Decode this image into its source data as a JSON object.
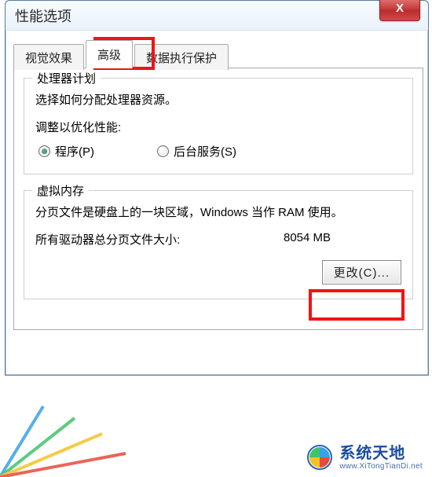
{
  "window": {
    "title": "性能选项",
    "close_label": "X"
  },
  "tabs": {
    "items": [
      {
        "label": "视觉效果"
      },
      {
        "label": "高级"
      },
      {
        "label": "数据执行保护"
      }
    ],
    "active_index": 1
  },
  "processor": {
    "group_title": "处理器计划",
    "desc": "选择如何分配处理器资源。",
    "adjust_label": "调整以优化性能:",
    "radios": [
      {
        "label": "程序(P)",
        "checked": true
      },
      {
        "label": "后台服务(S)",
        "checked": false
      }
    ]
  },
  "virtual_memory": {
    "group_title": "虚拟内存",
    "desc": "分页文件是硬盘上的一块区域，Windows 当作 RAM 使用。",
    "total_label": "所有驱动器总分页文件大小:",
    "total_value": "8054 MB",
    "change_button": "更改(C)..."
  },
  "watermark": {
    "cn": "系统天地",
    "en": "www.XiTongTianDi.net"
  }
}
